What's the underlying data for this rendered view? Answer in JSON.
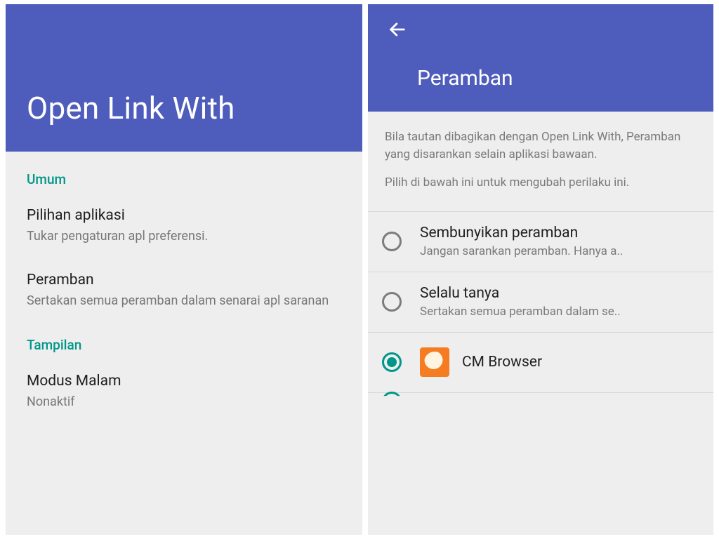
{
  "colors": {
    "primary": "#4e5dbc",
    "accent": "#009688"
  },
  "left": {
    "title": "Open Link With",
    "sections": {
      "umum": {
        "label": "Umum",
        "prefs": [
          {
            "title": "Pilihan aplikasi",
            "sub": "Tukar pengaturan apl preferensi."
          },
          {
            "title": "Peramban",
            "sub": "Sertakan semua peramban dalam senarai apl saranan"
          }
        ]
      },
      "tampilan": {
        "label": "Tampilan",
        "prefs": [
          {
            "title": "Modus Malam",
            "sub": "Nonaktif"
          }
        ]
      }
    }
  },
  "right": {
    "title": "Peramban",
    "info": {
      "p1": "Bila tautan dibagikan dengan Open Link With, Peramban yang disarankan selain aplikasi bawaan.",
      "p2": "Pilih di bawah ini untuk mengubah perilaku ini."
    },
    "options": [
      {
        "title": "Sembunyikan peramban",
        "sub": "Jangan sarankan peramban. Hanya a..",
        "selected": false,
        "app_icon": null
      },
      {
        "title": "Selalu tanya",
        "sub": "Sertakan semua peramban dalam se..",
        "selected": false,
        "app_icon": null
      },
      {
        "title": "CM Browser",
        "sub": "",
        "selected": true,
        "app_icon": "cm-browser-icon"
      }
    ]
  }
}
